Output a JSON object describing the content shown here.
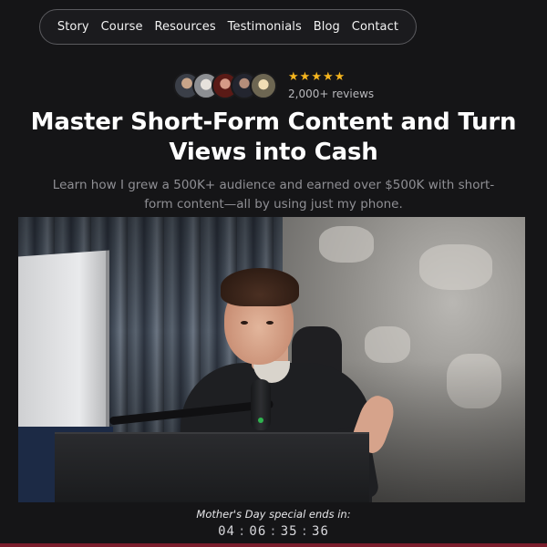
{
  "nav": {
    "items": [
      {
        "label": "Story"
      },
      {
        "label": "Course"
      },
      {
        "label": "Resources"
      },
      {
        "label": "Testimonials"
      },
      {
        "label": "Blog"
      },
      {
        "label": "Contact"
      }
    ]
  },
  "reviews": {
    "stars": [
      "★",
      "★",
      "★",
      "★",
      "★"
    ],
    "rating": 5,
    "count_label": "2,000+ reviews",
    "star_color": "#f5b51e"
  },
  "hero": {
    "headline": "Master Short-Form Content and Turn Views into Cash",
    "subheadline": "Learn how I grew a 500K+ audience and earned over $500K with short-form content—all by using just my phone."
  },
  "countdown": {
    "label": "Mother's Day special ends in:",
    "days": "04",
    "hours": "06",
    "minutes": "35",
    "seconds": "36",
    "separator": ":"
  },
  "colors": {
    "background": "#151517",
    "accent_bar": "#7a1d2c",
    "nav_border": "#5a5a5e",
    "subtext": "#8f8f94"
  }
}
